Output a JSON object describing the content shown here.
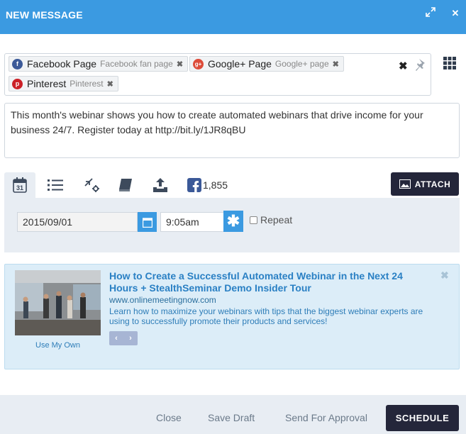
{
  "window": {
    "title": "NEW MESSAGE"
  },
  "recipients": [
    {
      "name": "Facebook Page",
      "sub": "Facebook fan page",
      "icon": "facebook-icon",
      "color": "#3b5998",
      "glyph": "f"
    },
    {
      "name": "Google+ Page",
      "sub": "Google+ page",
      "icon": "google-plus-icon",
      "color": "#dd4b39",
      "glyph": "g+"
    },
    {
      "name": "Pinterest",
      "sub": "Pinterest",
      "icon": "pinterest-icon",
      "color": "#cb2027",
      "glyph": "p"
    }
  ],
  "message": {
    "text": "This month's webinar shows you how to create automated webinars that drive income for your business 24/7. Register today at http://bit.ly/1JR8qBU"
  },
  "toolbar": {
    "facebook_count": "1,855",
    "attach_label": "ATTACH",
    "calendar_day": "31"
  },
  "schedule": {
    "date": "2015/09/01",
    "time": "9:05am",
    "repeat_label": "Repeat"
  },
  "preview": {
    "title": "How to Create a Successful Automated Webinar in the Next 24 Hours + StealthSeminar Demo Insider Tour",
    "url": "www.onlinemeetingnow.com",
    "description": "Learn how to maximize your webinars with tips that the biggest webinar experts are using to successfully promote their products and services!",
    "use_own_label": "Use My Own"
  },
  "footer": {
    "close_label": "Close",
    "save_draft_label": "Save Draft",
    "send_approval_label": "Send For Approval",
    "schedule_label": "SCHEDULE"
  },
  "colors": {
    "accent": "#3b9ae1",
    "dark_button": "#24263a",
    "panel": "#e8edf3"
  }
}
